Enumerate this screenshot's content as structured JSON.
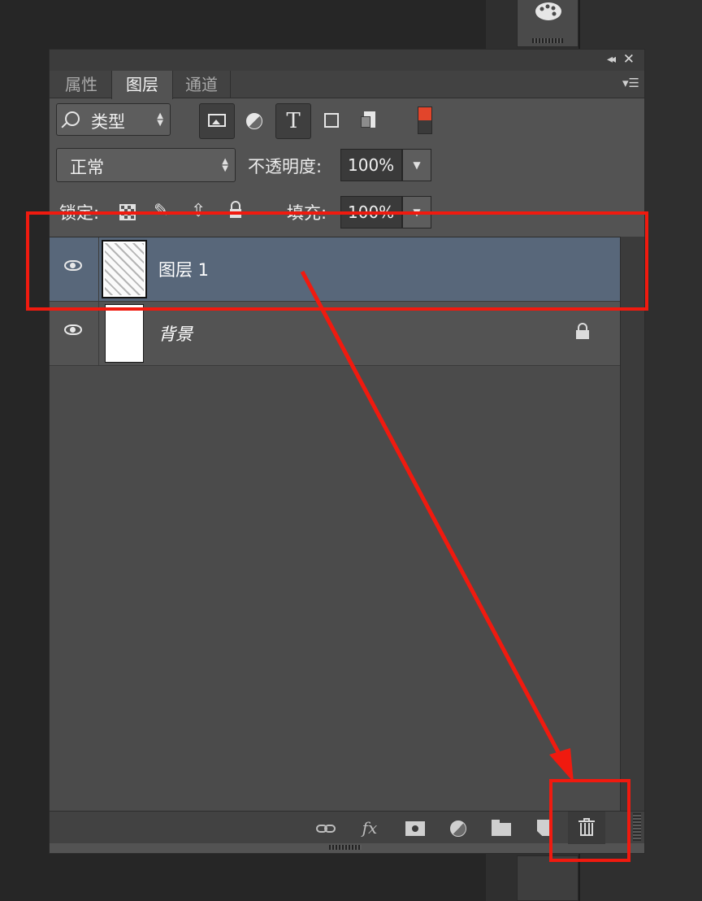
{
  "panel": {
    "tabs": [
      {
        "label": "属性",
        "active": false
      },
      {
        "label": "图层",
        "active": true
      },
      {
        "label": "通道",
        "active": false
      }
    ],
    "collapse_glyph": "◂◂",
    "close_glyph": "✕",
    "menu_glyph": "▾☰"
  },
  "filter": {
    "kind_label": "类型",
    "type_glyph": "T",
    "toggle_color": "#e2452b"
  },
  "blend": {
    "mode": "正常",
    "opacity_label": "不透明度:",
    "opacity_value": "100%"
  },
  "lock": {
    "label": "锁定:",
    "fill_label": "填充:",
    "fill_value": "100%",
    "paint_glyph": "✎",
    "move_glyph": "⇳"
  },
  "layers": [
    {
      "name": "图层 1",
      "visible": true,
      "selected": true
    },
    {
      "name": "背景",
      "visible": true,
      "selected": false,
      "locked": true
    }
  ],
  "bottom_toolbar": {
    "fx_label": "fx"
  },
  "annotation_color": "#f01a0f",
  "icons": {
    "filter": "magnifier-icon",
    "pixel": "image-icon",
    "adjustment": "half-circle-icon",
    "shape": "shape-icon",
    "smart": "smart-object-icon",
    "trash": "trash-icon"
  }
}
